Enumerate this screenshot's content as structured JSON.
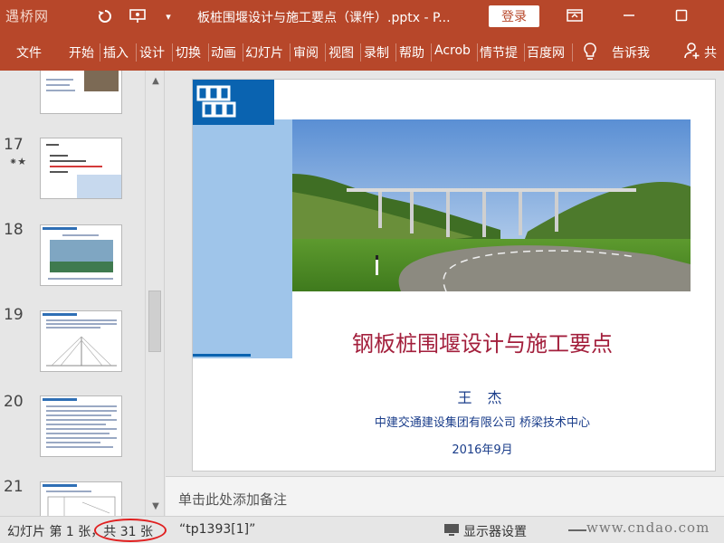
{
  "titlebar": {
    "logo_text": "遇桥网",
    "document_title": "板桩围堰设计与施工要点（课件）.pptx - P...",
    "login_label": "登录"
  },
  "ribbon": {
    "tabs": [
      "文件",
      "开始",
      "插入",
      "设计",
      "切换",
      "动画",
      "幻灯片",
      "审阅",
      "视图",
      "录制",
      "帮助",
      "Acrob",
      "情节提",
      "百度网",
      "告诉我",
      "共"
    ]
  },
  "thumbnails": [
    {
      "number": "17",
      "starred": true
    },
    {
      "number": "18",
      "starred": false
    },
    {
      "number": "19",
      "starred": false
    },
    {
      "number": "20",
      "starred": false
    },
    {
      "number": "21",
      "starred": false
    }
  ],
  "slide": {
    "title": "钢板桩围堰设计与施工要点",
    "author": "王 杰",
    "organization": "中建交通建设集团有限公司 桥梁技术中心",
    "date": "2016年9月"
  },
  "notes_placeholder": "单击此处添加备注",
  "statusbar": {
    "slide_position": "幻灯片 第 1 张，共 31 张",
    "template_name": "“tp1393[1]”",
    "display_settings": "显示器设置",
    "watermark": "www.cndao.com"
  },
  "colors": {
    "ribbon": "#b7472a",
    "slide_title": "#a31f3c",
    "slide_text": "#1a3d8a",
    "logo_blue": "#0a63b0",
    "highlight_circle": "#e02020"
  }
}
